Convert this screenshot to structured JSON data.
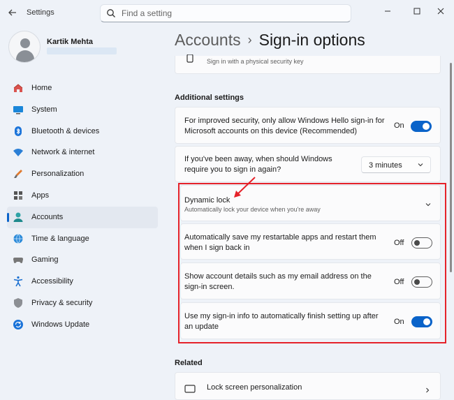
{
  "app": {
    "title": "Settings"
  },
  "search": {
    "placeholder": "Find a setting"
  },
  "user": {
    "name": "Kartik Mehta"
  },
  "nav": [
    {
      "label": "Home",
      "icon": "home-icon"
    },
    {
      "label": "System",
      "icon": "system-icon"
    },
    {
      "label": "Bluetooth & devices",
      "icon": "bluetooth-icon"
    },
    {
      "label": "Network & internet",
      "icon": "wifi-icon"
    },
    {
      "label": "Personalization",
      "icon": "brush-icon"
    },
    {
      "label": "Apps",
      "icon": "apps-icon"
    },
    {
      "label": "Accounts",
      "icon": "accounts-icon",
      "active": true
    },
    {
      "label": "Time & language",
      "icon": "globe-icon"
    },
    {
      "label": "Gaming",
      "icon": "gamepad-icon"
    },
    {
      "label": "Accessibility",
      "icon": "accessibility-icon"
    },
    {
      "label": "Privacy & security",
      "icon": "shield-icon"
    },
    {
      "label": "Windows Update",
      "icon": "update-icon"
    }
  ],
  "page": {
    "breadcrumb": "Accounts",
    "separator": "›",
    "title": "Sign-in options"
  },
  "security_key": {
    "subtitle": "Sign in with a physical security key"
  },
  "additional": {
    "header": "Additional settings",
    "hello_only": {
      "text": "For improved security, only allow Windows Hello sign-in for Microsoft accounts on this device (Recommended)",
      "state": "On"
    },
    "away": {
      "text": "If you've been away, when should Windows require you to sign in again?",
      "value": "3 minutes"
    },
    "dynamic_lock": {
      "title": "Dynamic lock",
      "subtitle": "Automatically lock your device when you're away"
    },
    "restart_apps": {
      "text": "Automatically save my restartable apps and restart them when I sign back in",
      "state": "Off"
    },
    "account_details": {
      "text": "Show account details such as my email address on the sign-in screen.",
      "state": "Off"
    },
    "finish_setup": {
      "text": "Use my sign-in info to automatically finish setting up after an update",
      "state": "On"
    }
  },
  "related": {
    "header": "Related",
    "lock_screen": "Lock screen personalization"
  },
  "colors": {
    "accent": "#0a63c9",
    "highlight": "#e5222a"
  }
}
